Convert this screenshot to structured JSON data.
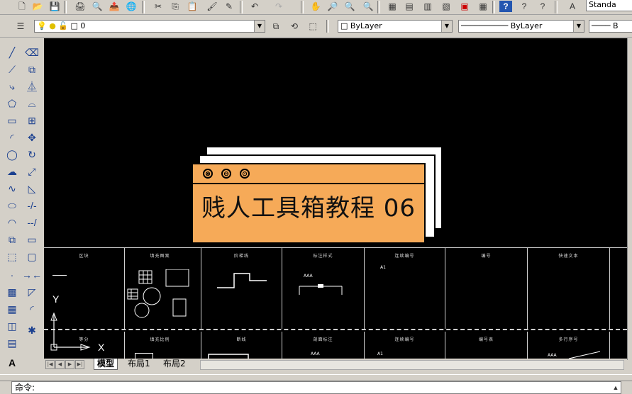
{
  "toolbar_top": {
    "text_style_combo": "Standa"
  },
  "layer_toolbar": {
    "layer_combo": "0",
    "color_combo": "ByLayer",
    "linetype_combo": "ByLayer",
    "lineweight_combo": "B"
  },
  "popup": {
    "title": "贱人工具箱教程 06",
    "buttons": [
      "⊗",
      "⊖",
      "⊙"
    ]
  },
  "drawing": {
    "ucs": {
      "y_label": "Y",
      "x_label": "X"
    },
    "cells_row1": [
      "区块",
      "填充图案",
      "阶梯线",
      "标注样式",
      "连续编号",
      "编号",
      "快速文本"
    ],
    "cells_row2": [
      "等分",
      "填充比例",
      "断线",
      "剖面标注",
      "连续编号",
      "编号表",
      "多行序号"
    ],
    "labels": {
      "aaa": "AAA",
      "a1": "A1"
    }
  },
  "tabs": {
    "model": "模型",
    "layout1": "布局1",
    "layout2": "布局2"
  },
  "command_line": {
    "prompt": "命令:"
  }
}
